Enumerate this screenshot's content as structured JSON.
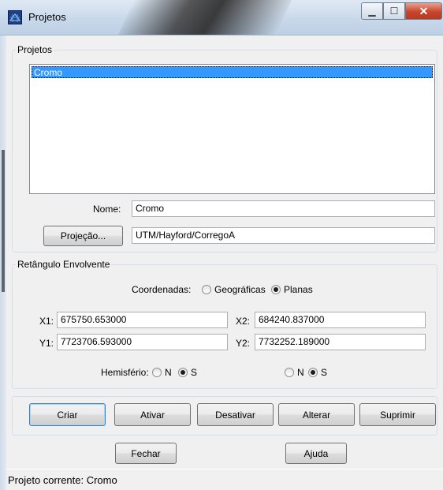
{
  "window": {
    "title": "Projetos",
    "icon": "globe-grid-icon",
    "min_glyph": "▁",
    "max_glyph": "☐",
    "close_glyph": "✕"
  },
  "projects_group": {
    "legend": "Projetos",
    "list_items": [
      "Cromo"
    ],
    "selected_item": "Cromo",
    "name_label": "Nome:",
    "name_value": "Cromo",
    "projection_button": "Projeção...",
    "projection_value": "UTM/Hayford/CorregoA"
  },
  "bbox_group": {
    "legend": "Retângulo Envolvente",
    "coords_label": "Coordenadas:",
    "coord_options": [
      "Geográficas",
      "Planas"
    ],
    "coord_selected": "Planas",
    "x1_label": "X1:",
    "x1_value": "675750.653000",
    "x2_label": "X2:",
    "x2_value": "684240.837000",
    "y1_label": "Y1:",
    "y1_value": "7723706.593000",
    "y2_label": "Y2:",
    "y2_value": "7732252.189000",
    "hemisphere_label": "Hemisfério:",
    "hemisphere_left": {
      "options": [
        "N",
        "S"
      ],
      "selected": "S"
    },
    "hemisphere_right": {
      "options": [
        "N",
        "S"
      ],
      "selected": "S"
    }
  },
  "actions": {
    "create": "Criar",
    "activate": "Ativar",
    "deactivate": "Desativar",
    "alter": "Alterar",
    "delete": "Suprimir",
    "close": "Fechar",
    "help": "Ajuda"
  },
  "status": {
    "current_project": "Projeto corrente: Cromo"
  },
  "colors": {
    "selection": "#3399ff",
    "dialog_bg": "#f0f0f0",
    "close_button": "#c7452c"
  }
}
